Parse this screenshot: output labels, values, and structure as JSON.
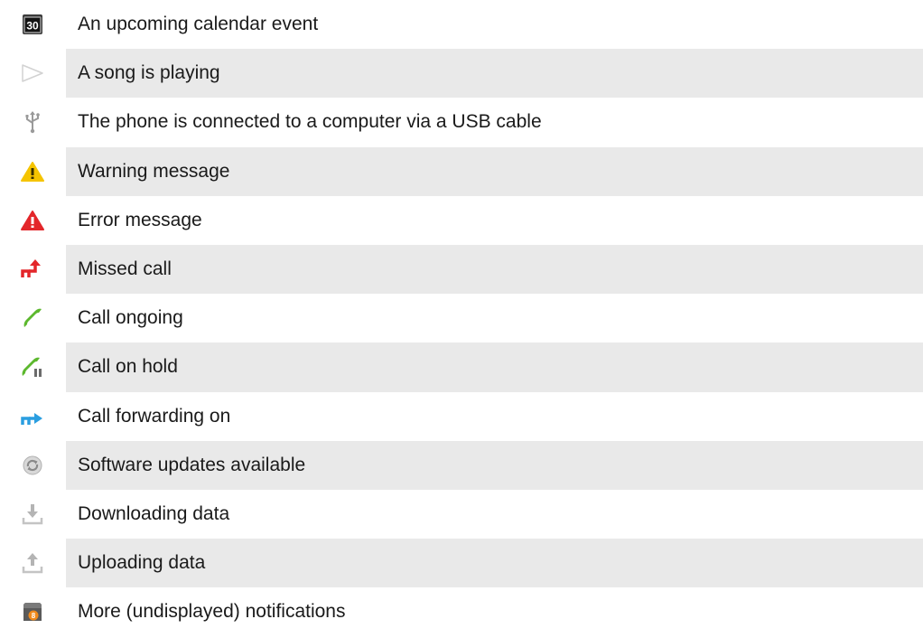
{
  "notifications": [
    {
      "icon": "calendar-icon",
      "badge_text": "30",
      "label": "An upcoming calendar event"
    },
    {
      "icon": "play-icon",
      "label": "A song is playing"
    },
    {
      "icon": "usb-icon",
      "label": "The phone is connected to a computer via a USB cable"
    },
    {
      "icon": "warning-icon",
      "label": "Warning message",
      "color": "#f5c400"
    },
    {
      "icon": "error-icon",
      "label": "Error message",
      "color": "#e3262a"
    },
    {
      "icon": "missed-call-icon",
      "label": "Missed call",
      "color": "#e3262a"
    },
    {
      "icon": "call-ongoing-icon",
      "label": "Call ongoing",
      "color": "#5cb82e"
    },
    {
      "icon": "call-on-hold-icon",
      "label": "Call on hold",
      "color": "#5cb82e"
    },
    {
      "icon": "call-forwarding-icon",
      "label": "Call forwarding on",
      "color": "#2a9ee0"
    },
    {
      "icon": "software-update-icon",
      "label": "Software updates available"
    },
    {
      "icon": "download-icon",
      "label": "Downloading data"
    },
    {
      "icon": "upload-icon",
      "label": "Uploading data"
    },
    {
      "icon": "more-notifications-icon",
      "badge_text": "8",
      "label": "More (undisplayed) notifications",
      "color": "#f08a1c"
    }
  ],
  "colors": {
    "row_shade": "#e9e9e9",
    "text": "#1a1a1a"
  }
}
